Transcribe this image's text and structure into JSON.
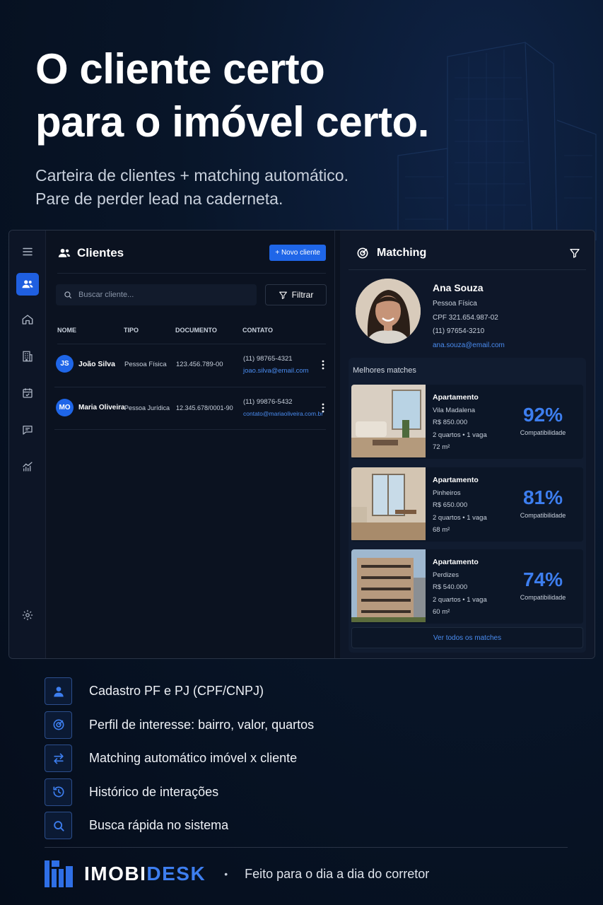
{
  "hero": {
    "title_line1": "O cliente certo",
    "title_line2": "para o imóvel certo.",
    "subtitle_line1": "Carteira de clientes + matching automático.",
    "subtitle_line2": "Pare de perder lead na caderneta."
  },
  "sidebar": {
    "items": [
      "menu-icon",
      "clients-icon",
      "home-icon",
      "building-icon",
      "calendar-icon",
      "chat-icon",
      "chart-icon",
      "gear-icon"
    ]
  },
  "clients": {
    "title": "Clientes",
    "new_label": "+ Novo cliente",
    "search_placeholder": "Buscar cliente...",
    "filter_label": "Filtrar",
    "columns": [
      "NOME",
      "TIPO",
      "DOCUMENTO",
      "CONTATO"
    ],
    "rows": [
      {
        "initials": "JS",
        "name": "João Silva",
        "type": "Pessoa Física",
        "document": "123.456.789-00",
        "phone": "(11) 98765-4321",
        "email": "joao.silva@email.com"
      },
      {
        "initials": "MO",
        "name": "Maria Oliveira",
        "type": "Pessoa Jurídica",
        "document": "12.345.678/0001-90",
        "phone": "(11) 99876-5432",
        "email": "contato@mariaoliveira.com.br"
      }
    ]
  },
  "matching": {
    "title": "Matching",
    "profile": {
      "name": "Ana Souza",
      "type": "Pessoa Física",
      "cpf": "CPF 321.654.987-02",
      "phone": "(11) 97654-3210",
      "email": "ana.souza@email.com"
    },
    "best_label": "Melhores matches",
    "cards": [
      {
        "kind": "Apartamento",
        "area": "Vila Madalena",
        "price": "R$ 850.000",
        "rooms": "2 quartos • 1 vaga",
        "size": "72 m²",
        "pct": "92%",
        "pct_label": "Compatibilidade"
      },
      {
        "kind": "Apartamento",
        "area": "Pinheiros",
        "price": "R$ 650.000",
        "rooms": "2 quartos • 1 vaga",
        "size": "68 m²",
        "pct": "81%",
        "pct_label": "Compatibilidade"
      },
      {
        "kind": "Apartamento",
        "area": "Perdizes",
        "price": "R$ 540.000",
        "rooms": "2 quartos • 1 vaga",
        "size": "60 m²",
        "pct": "74%",
        "pct_label": "Compatibilidade"
      }
    ],
    "see_all": "Ver todos os matches"
  },
  "features": [
    {
      "icon": "user-icon",
      "text": "Cadastro PF e PJ (CPF/CNPJ)"
    },
    {
      "icon": "target-icon",
      "text": "Perfil de interesse: bairro, valor, quartos"
    },
    {
      "icon": "swap-icon",
      "text": "Matching automático imóvel x cliente"
    },
    {
      "icon": "history-icon",
      "text": "Histórico de interações"
    },
    {
      "icon": "search-icon",
      "text": "Busca rápida no sistema"
    }
  ],
  "footer": {
    "brand_part1": "IMOBI",
    "brand_part2": "DESK",
    "separator": "•",
    "tagline": "Feito para o dia a dia do corretor"
  },
  "colors": {
    "accent": "#1f66e8",
    "accent_text": "#3d7eef",
    "background": "#06101f",
    "panel": "#0b1220"
  }
}
